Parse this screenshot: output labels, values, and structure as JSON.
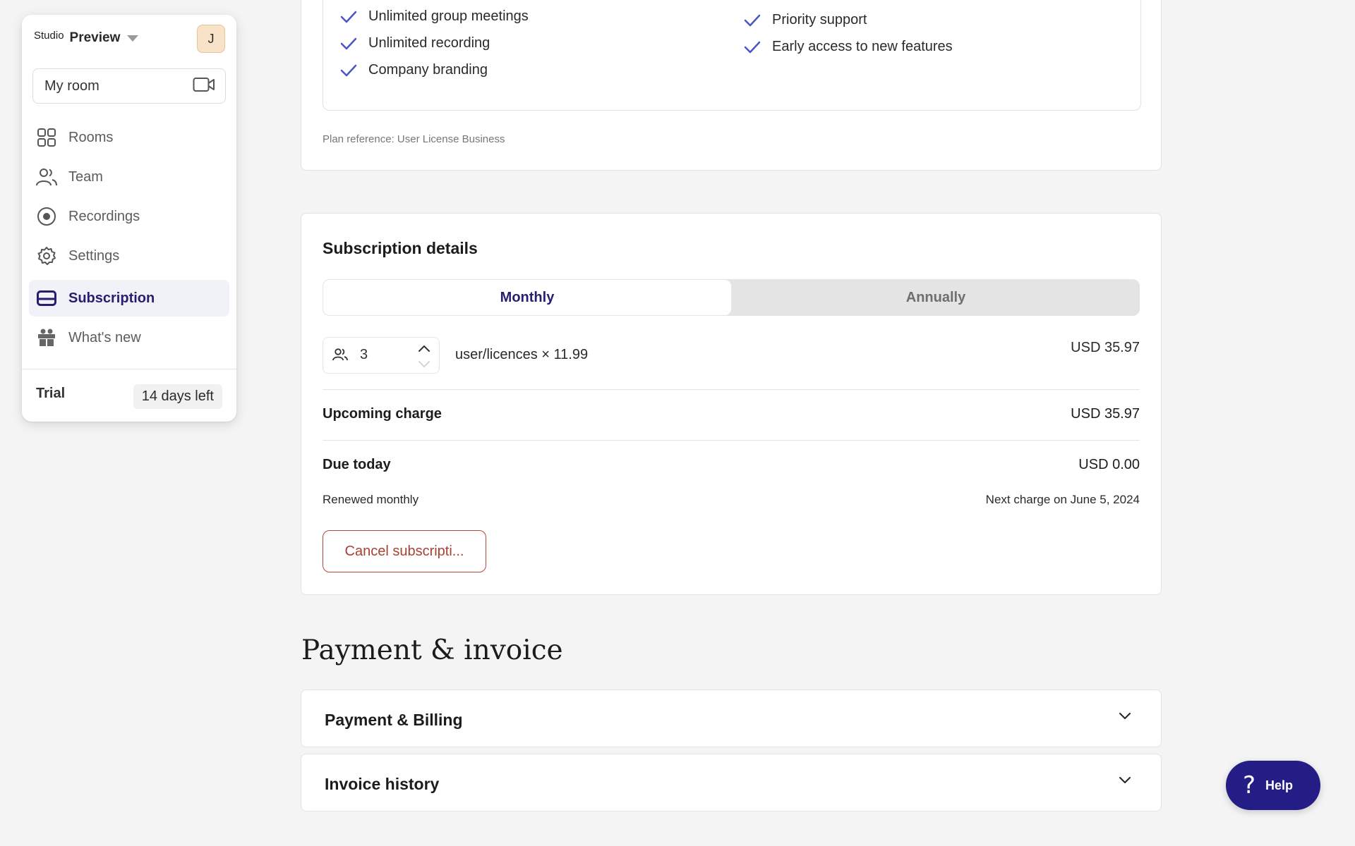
{
  "sidebar": {
    "workspace_prefix": "Studio",
    "workspace_name": "Preview",
    "avatar_initial": "J",
    "my_room_label": "My room",
    "items": [
      {
        "label": "Rooms",
        "icon": "grid-icon"
      },
      {
        "label": "Team",
        "icon": "people-icon"
      },
      {
        "label": "Recordings",
        "icon": "record-icon"
      },
      {
        "label": "Settings",
        "icon": "gear-icon"
      },
      {
        "label": "Subscription",
        "icon": "card-icon",
        "active": true
      },
      {
        "label": "What's new",
        "icon": "gift-icon"
      }
    ],
    "trial_label": "Trial",
    "trial_days": "14 days left"
  },
  "features": {
    "left": [
      "Unlimited group meetings",
      "Unlimited recording",
      "Company branding"
    ],
    "right": [
      "Priority support",
      "Early access to new features"
    ],
    "plan_reference": "Plan reference: User License Business"
  },
  "subscription": {
    "title": "Subscription details",
    "tabs": {
      "monthly": "Monthly",
      "annually": "Annually",
      "selected": "Monthly"
    },
    "quantity": "3",
    "licence_text": "user/licences × 11.99",
    "licence_total": "USD 35.97",
    "upcoming_label": "Upcoming charge",
    "upcoming_value": "USD 35.97",
    "due_label": "Due today",
    "due_value": "USD 0.00",
    "renewal": "Renewed monthly",
    "next_charge": "Next charge on June 5, 2024",
    "cancel_label": "Cancel subscripti..."
  },
  "payment": {
    "title": "Payment & invoice",
    "sections": [
      "Payment & Billing",
      "Invoice history"
    ]
  },
  "help_label": "Help",
  "colors": {
    "accent": "#251d86",
    "danger": "#b04a3a",
    "check": "#4b55c4"
  }
}
